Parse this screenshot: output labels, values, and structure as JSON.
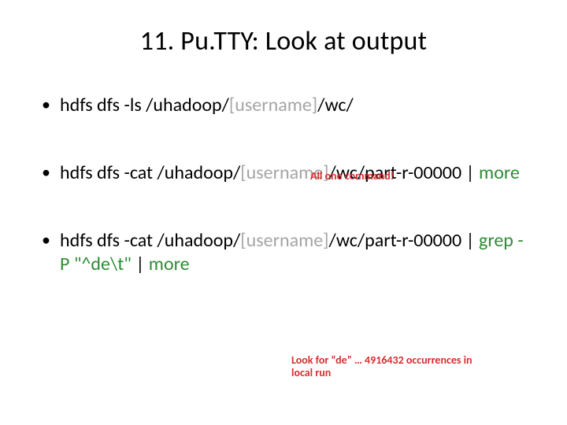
{
  "title": "11. Pu.TTY: Look at output",
  "bullets": [
    {
      "pre": "hdfs dfs -ls /uhadoop/",
      "gray": "[username]",
      "post1": "/wc/",
      "green": "",
      "post2": ""
    },
    {
      "pre": "hdfs dfs -cat /uhadoop/",
      "gray": "[username]",
      "post1": "/wc/part-r-00000 | ",
      "green": "more",
      "post2": ""
    },
    {
      "pre": "hdfs dfs -cat /uhadoop/",
      "gray": "[username]",
      "post1": "/wc/part-r-00000 | ",
      "green": "grep -P \"^de\\t\"",
      "post2": " | ",
      "green2": "more"
    }
  ],
  "callout_top": "All one command!",
  "callout_bottom": "Look for “de” … 4916432 occurrences in local run"
}
